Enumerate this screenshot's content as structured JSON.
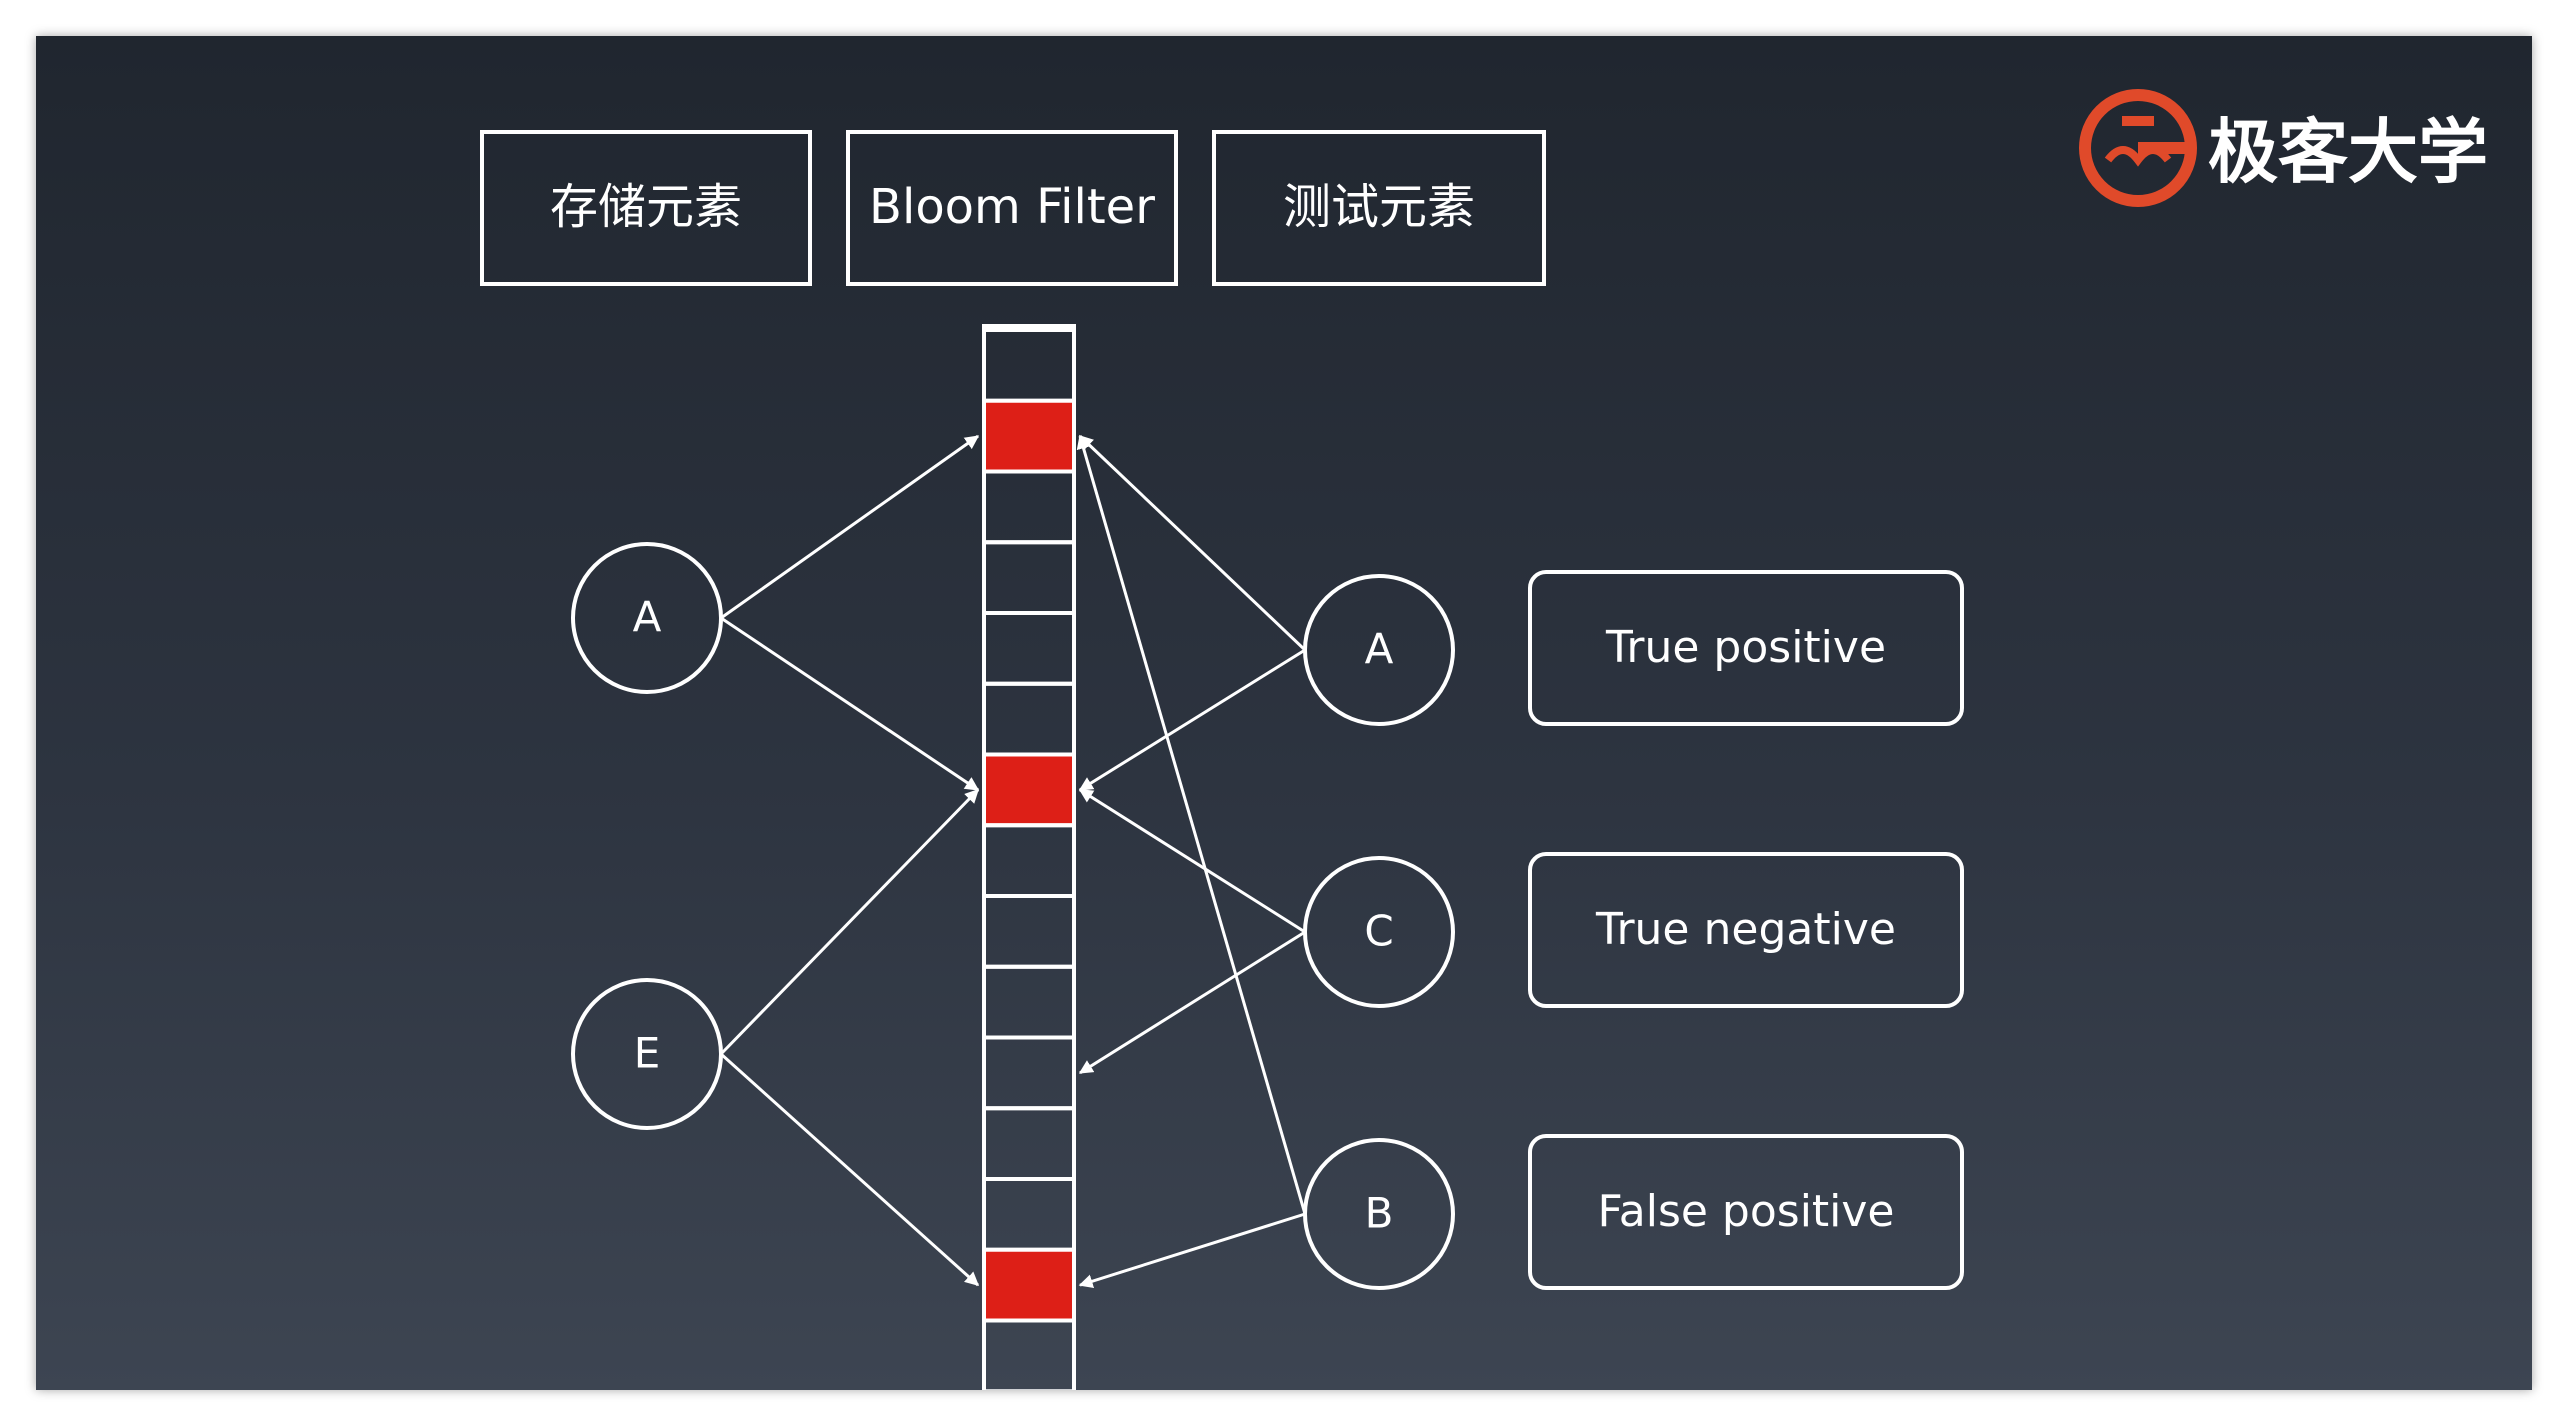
{
  "headers": {
    "store": "存储元素",
    "filter": "Bloom Filter",
    "test": "测试元素"
  },
  "bit_array": {
    "cell_count": 15,
    "set_bits": [
      1,
      6,
      13
    ],
    "set_color": "#dd1f17",
    "empty_color": "#2d3440",
    "border_color": "#ffffff"
  },
  "stored_elements": [
    {
      "label": "A",
      "targets": [
        1,
        6
      ]
    },
    {
      "label": "E",
      "targets": [
        6,
        13
      ]
    }
  ],
  "tested_elements": [
    {
      "label": "A",
      "targets": [
        1,
        6
      ]
    },
    {
      "label": "C",
      "targets": [
        6,
        10
      ]
    },
    {
      "label": "B",
      "targets": [
        1,
        13
      ]
    }
  ],
  "results": [
    "True positive",
    "True negative",
    "False positive"
  ],
  "logo": {
    "text": "极客大学",
    "color": "#e04a2a"
  }
}
